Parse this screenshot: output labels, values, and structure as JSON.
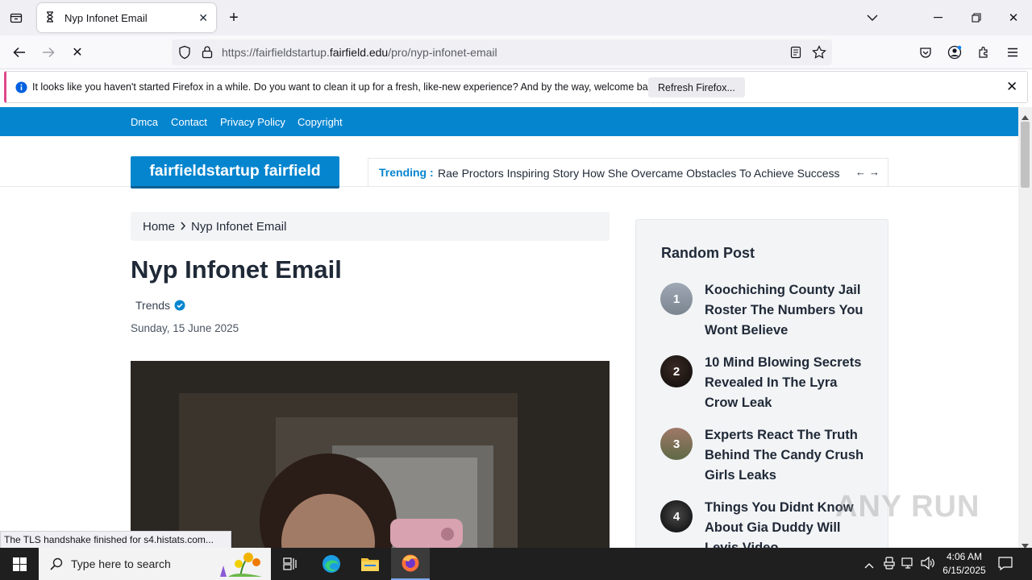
{
  "browser": {
    "tab_title": "Nyp Infonet Email",
    "url_prefix": "https://fairfieldstartup.",
    "url_domain": "fairfield.edu",
    "url_path": "/pro/nyp-infonet-email"
  },
  "notification": {
    "message": "It looks like you haven't started Firefox in a while. Do you want to clean it up for a fresh, like-new experience? And by the way, welcome back!",
    "button_label": "Refresh Firefox..."
  },
  "site": {
    "nav": [
      "Dmca",
      "Contact",
      "Privacy Policy",
      "Copyright"
    ],
    "logo": "fairfieldstartup fairfield",
    "trending_label": "Trending :",
    "trending_text": "Rae Proctors Inspiring Story How She Overcame Obstacles To Achieve Success"
  },
  "article": {
    "breadcrumb_home": "Home",
    "breadcrumb_current": "Nyp Infonet Email",
    "title": "Nyp Infonet Email",
    "author": "Trends",
    "date": "Sunday, 15 June 2025"
  },
  "sidebar": {
    "title": "Random Post",
    "posts": [
      {
        "num": "1",
        "title": "Koochiching County Jail Roster The Numbers You Wont Believe"
      },
      {
        "num": "2",
        "title": "10 Mind Blowing Secrets Revealed In The Lyra Crow Leak"
      },
      {
        "num": "3",
        "title": "Experts React The Truth Behind The Candy Crush Girls Leaks"
      },
      {
        "num": "4",
        "title": "Things You Didnt Know About Gia Duddy Will Levis Video"
      }
    ]
  },
  "status_tip": "The TLS handshake finished for s4.histats.com...",
  "watermark": "ANY RUN",
  "taskbar": {
    "search_placeholder": "Type here to search",
    "time": "4:06 AM",
    "date": "6/15/2025"
  },
  "colors": {
    "brand_blue": "#0685cf",
    "notice_accent": "#e0488a"
  }
}
